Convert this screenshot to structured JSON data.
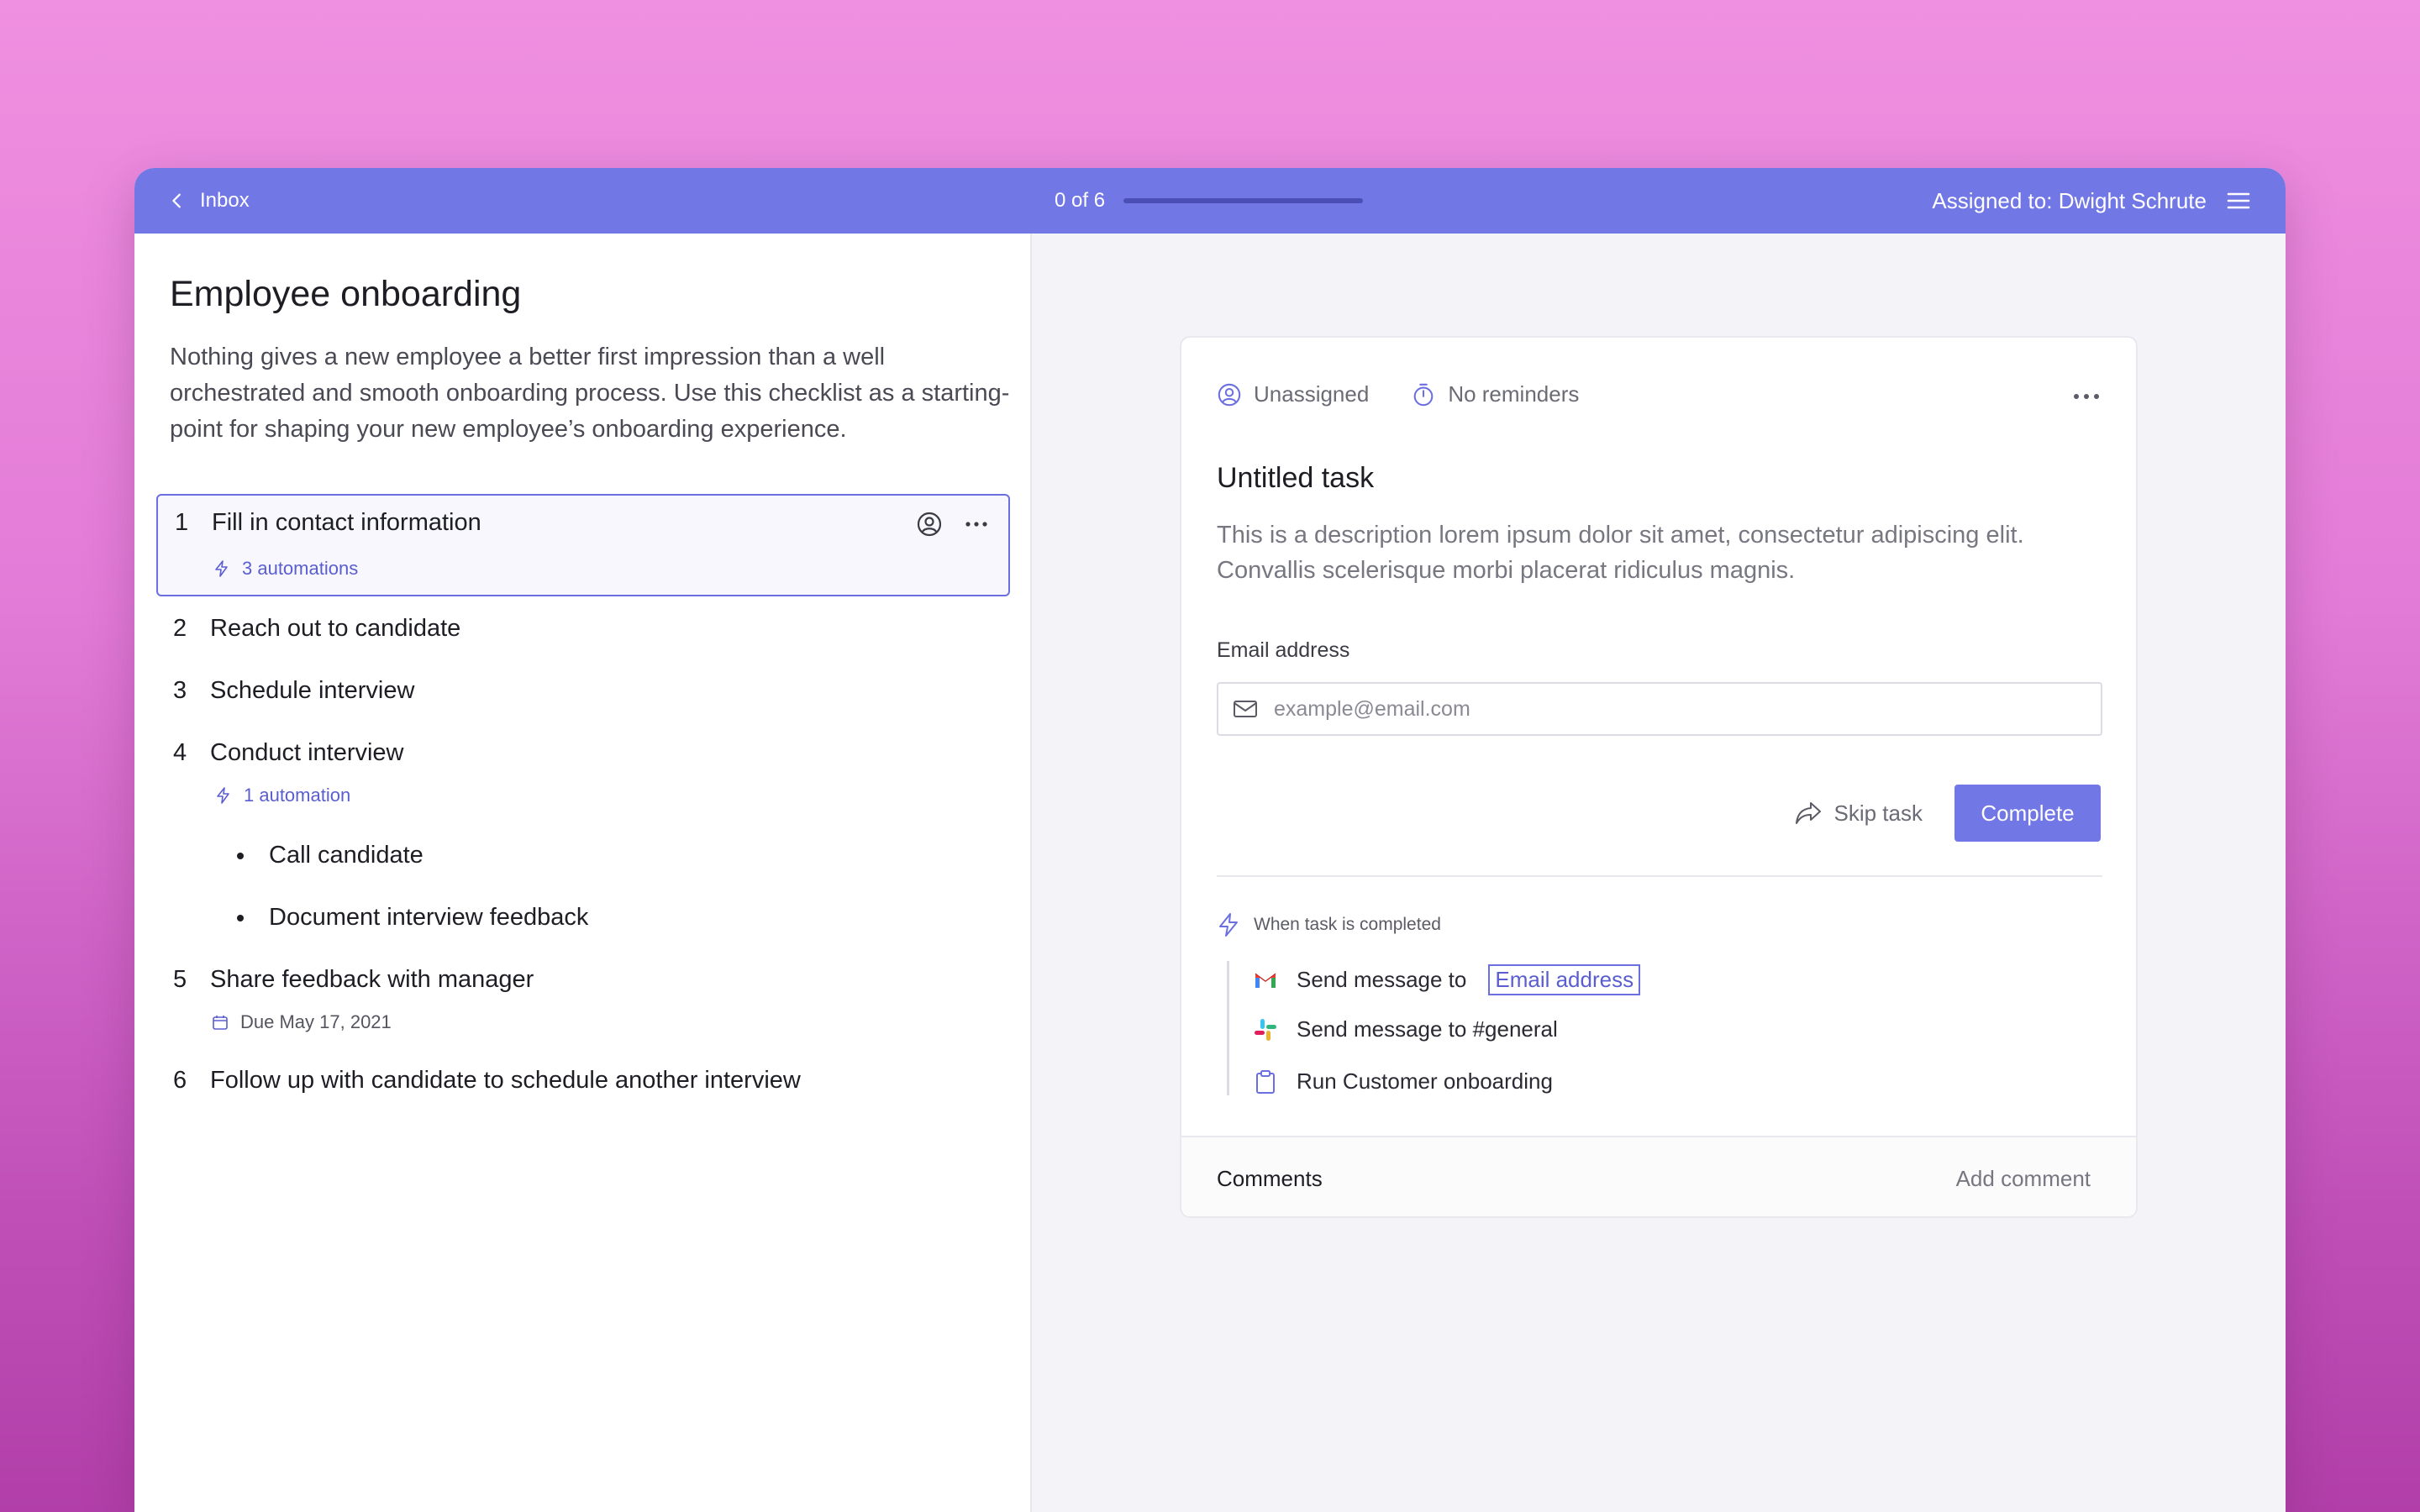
{
  "topbar": {
    "back_label": "Inbox",
    "progress_text": "0 of 6",
    "progress_fraction": 0,
    "assigned_text": "Assigned to: Dwight Schrute"
  },
  "checklist": {
    "title": "Employee onboarding",
    "description": "Nothing gives a new employee a better first impression than a well orchestrated and smooth onboarding process. Use this checklist as a starting-point for shaping your new employee’s onboarding experience.",
    "tasks": [
      {
        "num": "1",
        "label": "Fill in contact information",
        "sub": "3 automations"
      },
      {
        "num": "2",
        "label": "Reach out to candidate"
      },
      {
        "num": "3",
        "label": "Schedule interview"
      },
      {
        "num": "4",
        "label": "Conduct interview",
        "sub": "1 automation",
        "subtasks": [
          "Call candidate",
          "Document interview feedback"
        ]
      },
      {
        "num": "5",
        "label": "Share feedback with manager",
        "due": "Due May 17, 2021"
      },
      {
        "num": "6",
        "label": "Follow up with candidate to schedule another interview"
      }
    ]
  },
  "task_card": {
    "assignee": "Unassigned",
    "reminders": "No reminders",
    "title": "Untitled task",
    "description": "This is a description lorem ipsum dolor sit amet, consectetur adipiscing elit. Convallis scelerisque morbi placerat ridiculus magnis.",
    "field_label": "Email address",
    "email_placeholder": "example@email.com",
    "skip_label": "Skip task",
    "complete_label": "Complete",
    "automation_header": "When task is completed",
    "automations": [
      {
        "icon": "gmail-icon",
        "text": "Send message to",
        "variable": "Email address"
      },
      {
        "icon": "slack-icon",
        "text": "Send message to #general"
      },
      {
        "icon": "clipboard-icon",
        "text": "Run Customer onboarding"
      }
    ],
    "comments_title": "Comments",
    "add_comment": "Add comment"
  },
  "colors": {
    "accent": "#7277e6",
    "link": "#5a5ecf"
  }
}
